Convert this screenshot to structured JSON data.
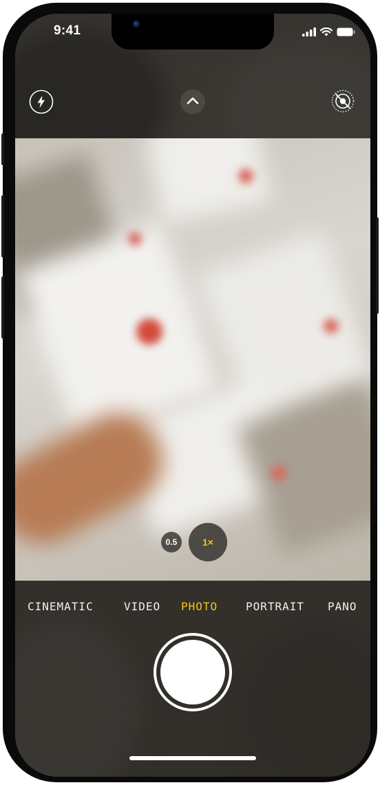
{
  "status_bar": {
    "time": "9:41",
    "icons": [
      "cellular-signal-icon",
      "wifi-icon",
      "battery-icon"
    ]
  },
  "top_controls": {
    "flash_icon": "flash-icon",
    "chevron_icon": "chevron-up-icon",
    "live_photo_icon": "live-photo-off-icon"
  },
  "zoom": {
    "options": [
      "0.5",
      "1×"
    ],
    "selected": "1×"
  },
  "modes": {
    "items": [
      "CINEMATIC",
      "VIDEO",
      "PHOTO",
      "PORTRAIT",
      "PANO"
    ],
    "active": "PHOTO"
  },
  "colors": {
    "accent": "#f5c518",
    "text": "#f2f2f2"
  }
}
